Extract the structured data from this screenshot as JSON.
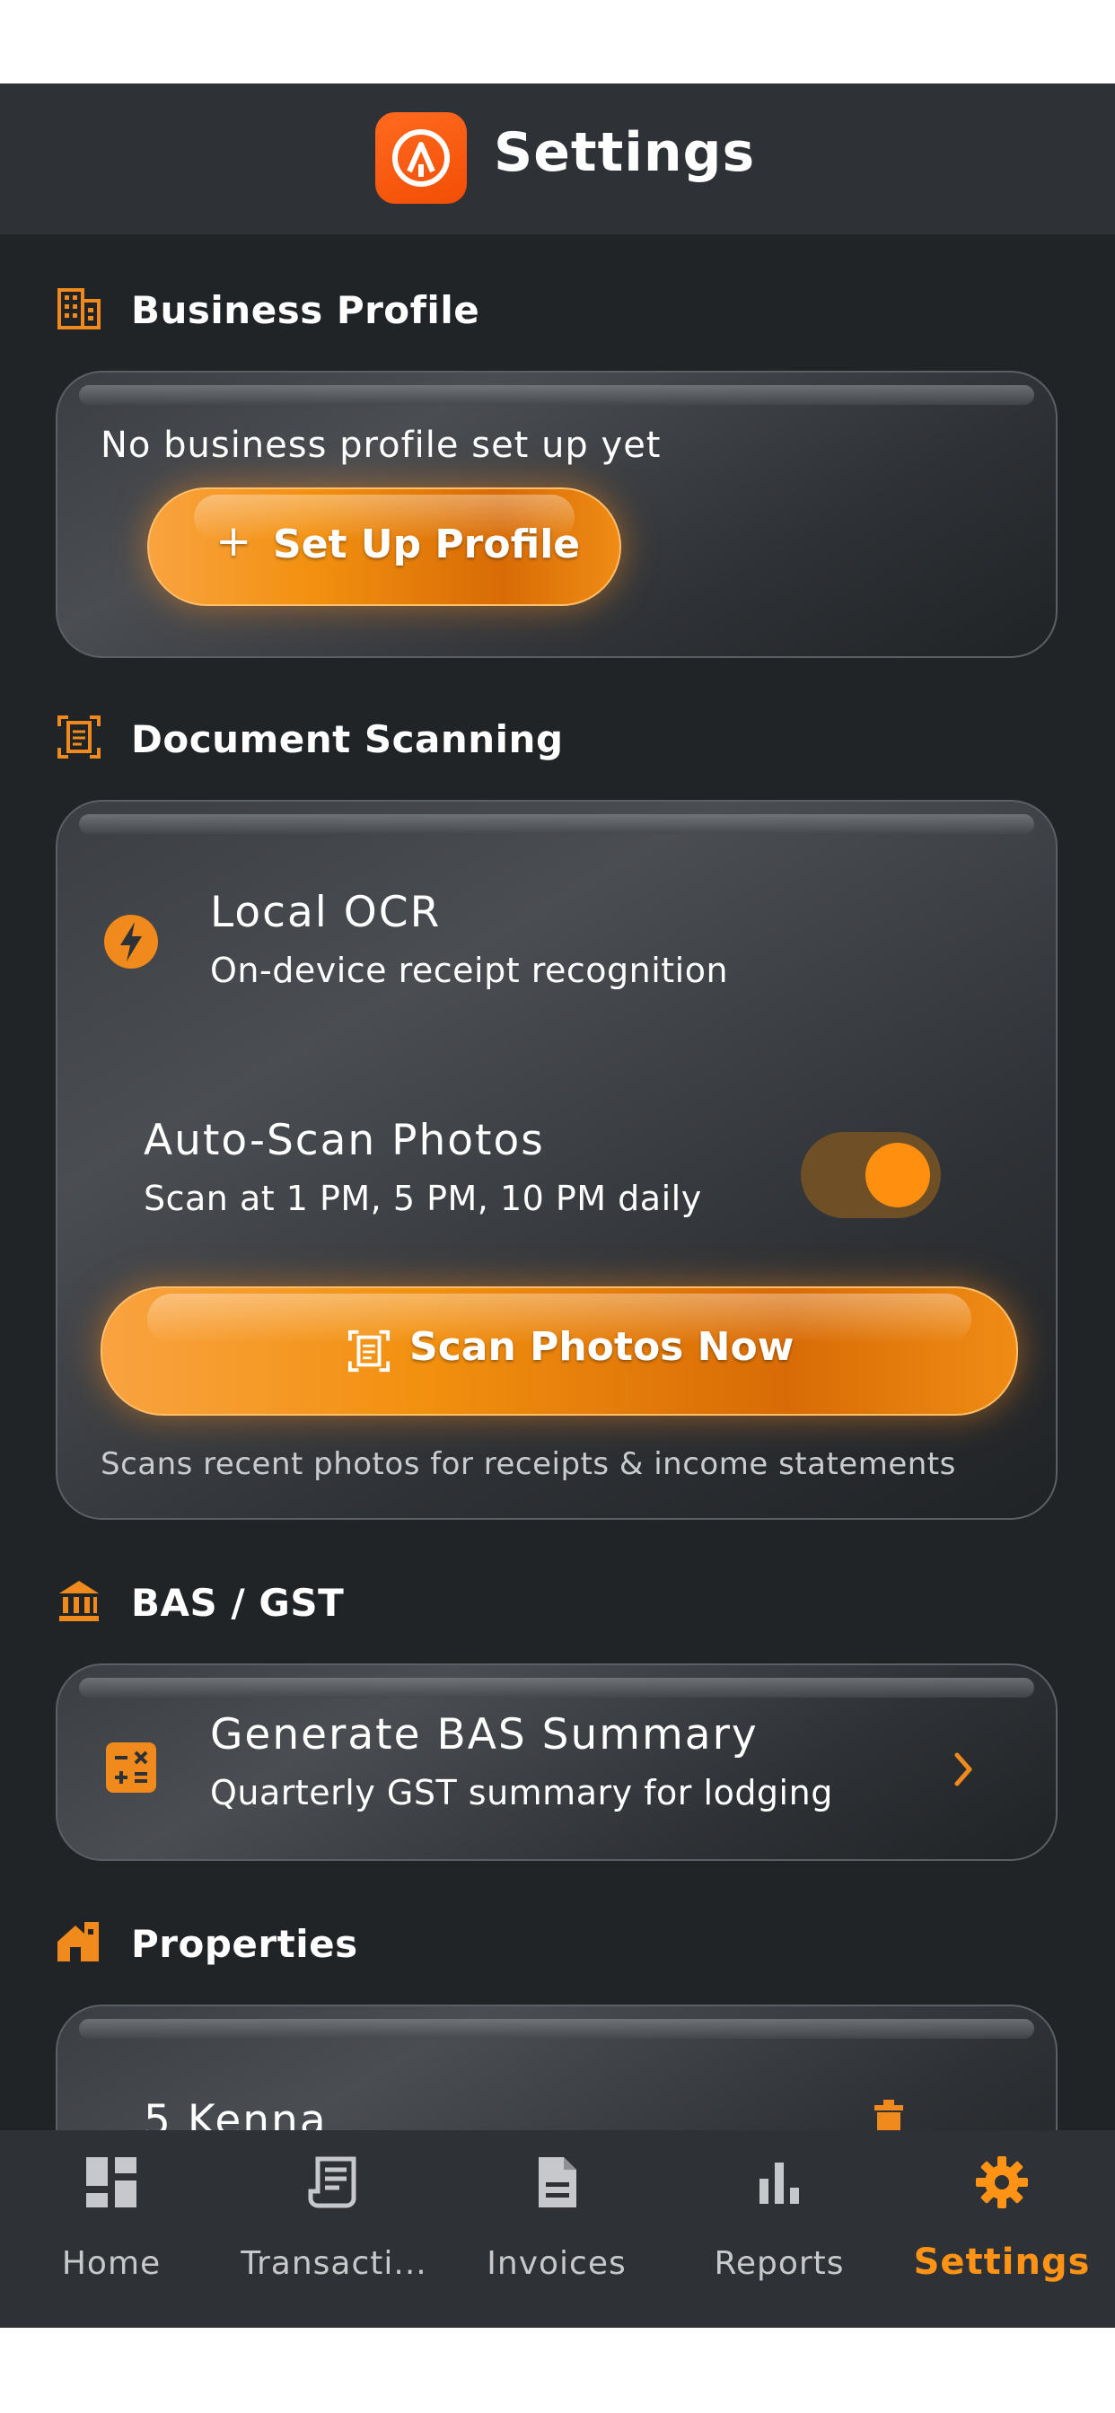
{
  "header": {
    "title": "Settings"
  },
  "sections": {
    "business": {
      "title": "Business Profile",
      "empty_text": "No business profile set up yet",
      "setup_button": "Set Up Profile",
      "setup_icon": "+"
    },
    "scanning": {
      "title": "Document Scanning",
      "ocr_title": "Local OCR",
      "ocr_subtitle": "On-device receipt recognition",
      "auto_title": "Auto-Scan Photos",
      "auto_subtitle": "Scan at 1 PM, 5 PM, 10 PM daily",
      "auto_enabled": true,
      "scan_button": "Scan Photos Now",
      "scan_hint": "Scans recent photos for receipts & income statements"
    },
    "bas": {
      "title": "BAS / GST",
      "item_title": "Generate BAS Summary",
      "item_subtitle": "Quarterly GST summary for lodging"
    },
    "properties": {
      "title": "Properties",
      "first_property": "5 Kenna"
    }
  },
  "nav": {
    "items": [
      {
        "label": "Home",
        "icon": "dashboard-icon"
      },
      {
        "label": "Transacti...",
        "icon": "receipt-icon"
      },
      {
        "label": "Invoices",
        "icon": "document-icon"
      },
      {
        "label": "Reports",
        "icon": "bar-chart-icon"
      },
      {
        "label": "Settings",
        "icon": "gear-icon",
        "active": true
      }
    ]
  },
  "colors": {
    "accent": "#ff9316",
    "background": "#212427",
    "header": "#2e3236",
    "logo": "#f55510"
  }
}
